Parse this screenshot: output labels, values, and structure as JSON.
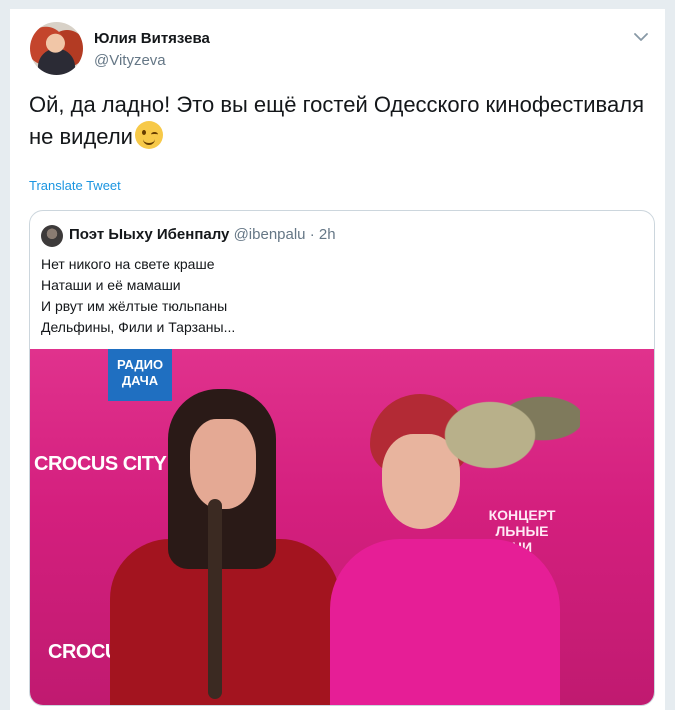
{
  "tweet": {
    "author_name": "Юлия Витязева",
    "author_handle": "@Vityzeva",
    "text": "Ой, да ладно! Это вы ещё гостей Одесского кинофестиваля не видели",
    "translate_label": "Translate Tweet"
  },
  "quoted": {
    "author_name": "Поэт Ыыху Ибенпалу",
    "author_handle": "@ibenpalu",
    "separator": "·",
    "time": "2h",
    "lines": [
      "Нет никого на свете краше",
      "Наташи и её мамаши",
      "И рвут им жёлтые тюльпаны",
      "Дельфины, Фили и Тарзаны..."
    ],
    "photo_text": {
      "sign_top": "CROCUS CITY HAL",
      "sign_bottom": "CROCUS CI",
      "radio": "РАДИО ДАЧА",
      "concert": "КОНЦЕРТ ЛЬНЫЕ НИ"
    }
  },
  "icons": {
    "menu": "chevron-down-icon",
    "emoji": "winking-face"
  }
}
